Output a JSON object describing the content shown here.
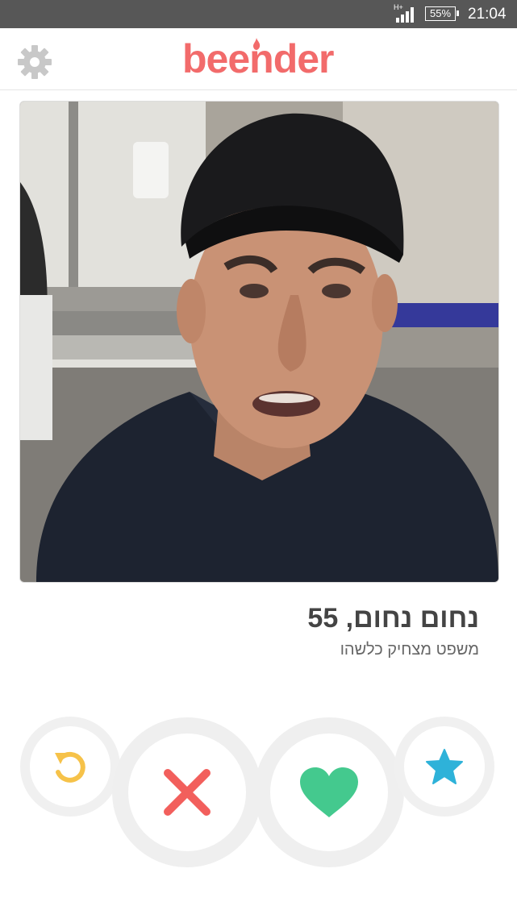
{
  "status_bar": {
    "network_label": "H+",
    "battery_label": "55%",
    "time": "21:04"
  },
  "header": {
    "logo_text": "beender",
    "settings_icon": "gear-icon"
  },
  "profile": {
    "name_age": "נחום נחום, 55",
    "bio": "משפט מצחיק כלשהו"
  },
  "actions": [
    {
      "name": "rewind-button",
      "icon": "undo-icon",
      "color": "#f6c249"
    },
    {
      "name": "dislike-button",
      "icon": "close-icon",
      "color": "#f25f5c"
    },
    {
      "name": "like-button",
      "icon": "heart-icon",
      "color": "#44c98e"
    },
    {
      "name": "super-like-button",
      "icon": "star-icon",
      "color": "#2eb2d9"
    }
  ],
  "colors": {
    "brand": "#f26b6b",
    "status_bar_bg": "#575757"
  }
}
